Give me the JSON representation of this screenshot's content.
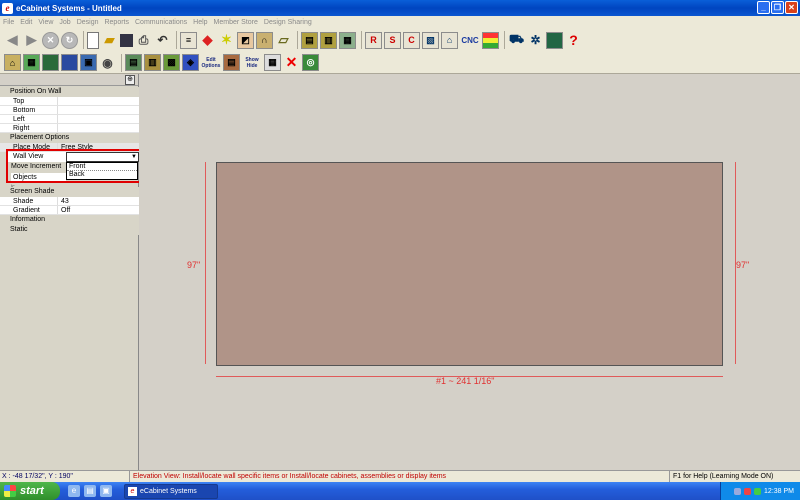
{
  "window": {
    "title": "eCabinet Systems - Untitled",
    "icon_glyph": "e",
    "buttons": [
      "_",
      "❐",
      "✕"
    ]
  },
  "menu": [
    "File",
    "Edit",
    "View",
    "Job",
    "Design",
    "Reports",
    "Communications",
    "Help",
    "Member Store",
    "Design Sharing"
  ],
  "toolbar1": {
    "icons": [
      "back-arrow",
      "forward-arrow",
      "stop",
      "refresh",
      "new-file",
      "open-folder",
      "save",
      "print",
      "undo",
      "sliders",
      "paint-brush",
      "light-burst",
      "materials",
      "arch-door",
      "plank",
      "cabinet",
      "cabinet-doors",
      "grid-pattern",
      "report-r",
      "report-s",
      "report-c",
      "lumber-stack",
      "house-part",
      "hardware-pack"
    ],
    "cnc_label": "CNC",
    "icons2": [
      "color-chart",
      "cart",
      "cart-settings",
      "monitor"
    ],
    "help_glyph": "?"
  },
  "toolbar2": {
    "icons": [
      "elevation-view",
      "wall-grid",
      "view-3d",
      "panel-view",
      "save-photo",
      "render-view",
      "cabinet-elevation",
      "textured-panel",
      "walls-layout",
      "hardware-blue"
    ],
    "edit_options": "Edit Options",
    "show_hide": "Show Hide",
    "icons3": [
      "cabinet-color",
      "grid-pattern-2",
      "delete-x",
      "camera-snap"
    ]
  },
  "panel": {
    "section_position": "Position On Wall",
    "position_rows": [
      {
        "k": "Top",
        "v": ""
      },
      {
        "k": "Bottom",
        "v": ""
      },
      {
        "k": "Left",
        "v": ""
      },
      {
        "k": "Right",
        "v": ""
      }
    ],
    "section_placement": "Placement Options",
    "place_mode_label": "Place Mode",
    "place_mode_value": "Free Style",
    "wall_view_label": "Wall View",
    "wall_view_options": [
      "Front",
      "Back"
    ],
    "move_increment_label": "Move Increment",
    "objects_label": "Objects",
    "objects_value": "",
    "hidden_fragment": "ic",
    "section_shade": "Screen Shade",
    "shade_rows": [
      {
        "k": "Shade",
        "v": "43"
      },
      {
        "k": "Gradient",
        "v": "Off"
      }
    ],
    "section_info": "Information",
    "static_label": "Static"
  },
  "canvas": {
    "left_dim": "97\"",
    "right_dim": "97\"",
    "bottom_dim": "#1 ~ 241 1/16\"",
    "wall_color": "#b09488",
    "dim_color": "#e03030"
  },
  "status": {
    "coords": "X : -48 17/32\", Y : 190\"",
    "message": "Elevation View: Install/locate wall specific items or Install/locate cabinets, assemblies or display items",
    "help": "F1 for Help (Learning Mode ON)"
  },
  "taskbar": {
    "start": "start",
    "task_label": "eCabinet Systems",
    "clock": "12:38 PM"
  }
}
